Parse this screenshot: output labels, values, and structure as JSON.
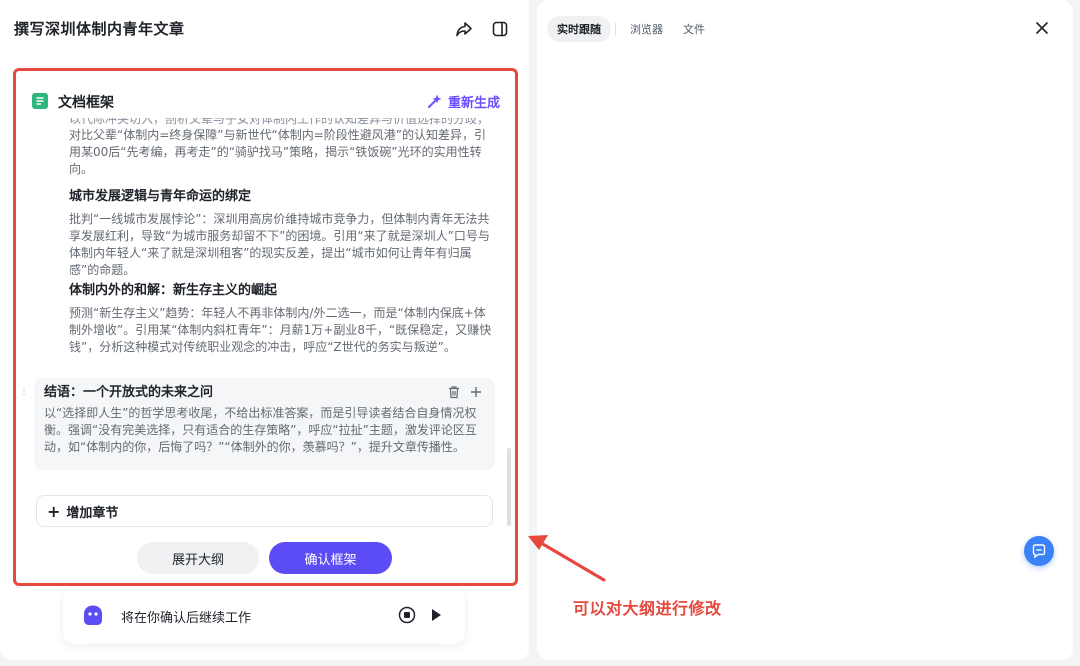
{
  "colors": {
    "accent": "#5b4cf5",
    "regen": "#6b4eff",
    "highlight": "#e6483d",
    "fab": "#3b82f6"
  },
  "left": {
    "title": "撰写深圳体制内青年文章",
    "icons": [
      "share-icon",
      "split-panel-icon"
    ],
    "doc": {
      "header_title": "文档框架",
      "regen_label": "重新生成",
      "cutoff_text": "以代际冲突切入，剖析父辈与子女对体制内工作的认知差异与价值选择的分歧，",
      "section1_body": "对比父辈“体制内=终身保障”与新世代“体制内=阶段性避风港”的认知差异，引用某00后“先考编，再考走”的“骑驴找马”策略，揭示“铁饭碗”光环的实用性转向。",
      "section2_title": "城市发展逻辑与青年命运的绑定",
      "section2_body": "批判“一线城市发展悖论”：深圳用高房价维持城市竞争力，但体制内青年无法共享发展红利，导致“为城市服务却留不下”的困境。引用“来了就是深圳人”口号与体制内年轻人“来了就是深圳租客”的现实反差，提出“城市如何让青年有归属感”的命题。",
      "section3_title": "体制内外的和解：新生存主义的崛起",
      "section3_body": "预测“新生存主义”趋势：年轻人不再非体制内/外二选一，而是“体制内保底+体制外增收”。引用某“体制内斜杠青年”：月薪1万+副业8千，“既保稳定，又赚快钱”，分析这种模式对传统职业观念的冲击，呼应“Z世代的务实与叛逆”。",
      "conclusion_title": "结语：一个开放式的未来之问",
      "conclusion_body": "以“选择即人生”的哲学思考收尾，不给出标准答案，而是引导读者结合自身情况权衡。强调“没有完美选择，只有适合的生存策略”，呼应“拉扯”主题，激发评论区互动，如“体制内的你，后悔了吗？”“体制外的你，羡慕吗？”，提升文章传播性。",
      "add_section_label": "增加章节",
      "expand_label": "展开大纲",
      "confirm_label": "确认框架"
    },
    "status_text": "将在你确认后继续工作"
  },
  "right": {
    "tabs": [
      "实时跟随",
      "浏览器",
      "文件"
    ],
    "active_tab": "实时跟随"
  },
  "annotation": "可以对大纲进行修改"
}
